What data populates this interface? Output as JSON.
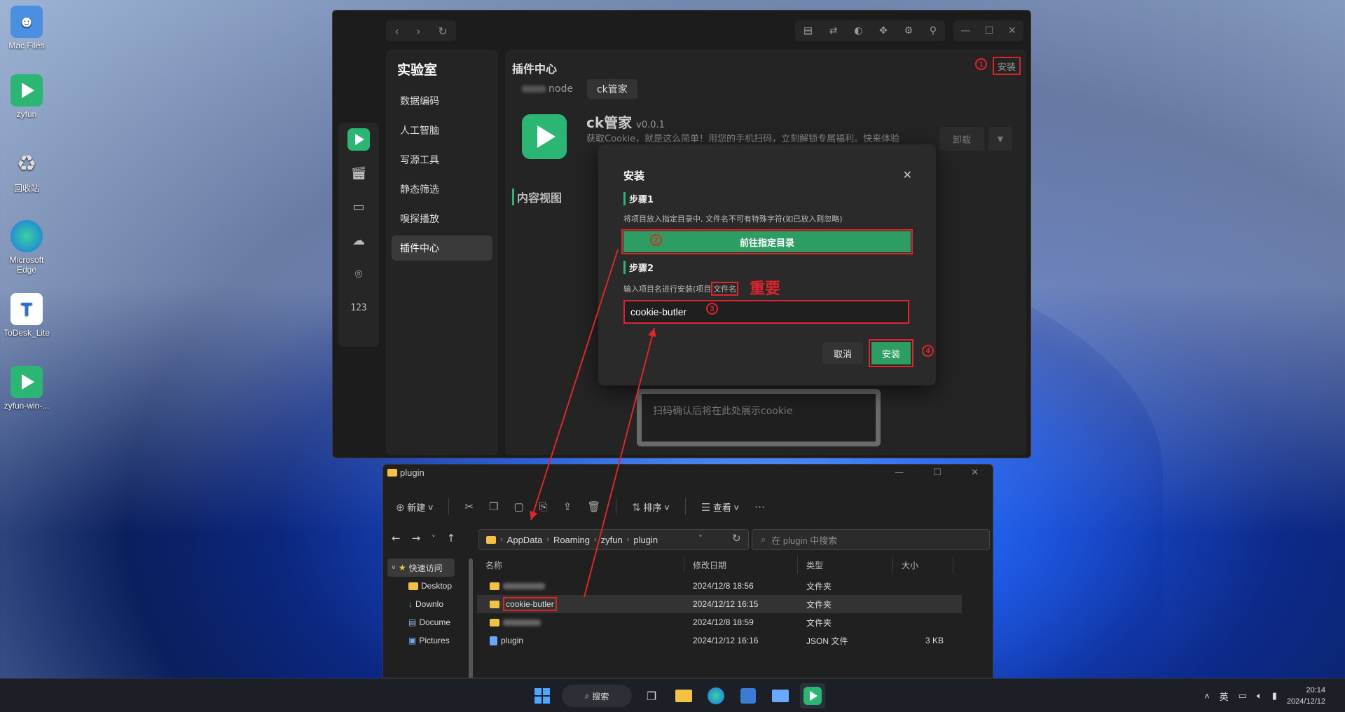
{
  "desktop": {
    "icons": [
      "Mac Files",
      "zyfun",
      "回收站",
      "Microsoft Edge",
      "ToDesk_Lite",
      "zyfun-win-..."
    ]
  },
  "app": {
    "menu_title": "实验室",
    "menu_items": [
      "数据编码",
      "人工智脑",
      "写源工具",
      "静态筛选",
      "嗅探播放",
      "插件中心"
    ],
    "content_title": "插件中心",
    "top_install_label": "安装",
    "tabs": [
      "node",
      "ck管家"
    ],
    "plugin": {
      "name": "ck管家",
      "version": "v0.0.1",
      "description": "获取Cookie，就是这么简单！用您的手机扫码，立刻解锁专属福利。快来体验",
      "unload_label": "卸载"
    },
    "content_view_title": "内容视图",
    "cookie_placeholder": "扫码确认后将在此处展示cookie"
  },
  "modal": {
    "title": "安装",
    "step1_title": "步骤1",
    "step1_hint": "将项目放入指定目录中, 文件名不可有特殊字符(如已放入则忽略)",
    "goto_dir_label": "前往指定目录",
    "step2_title": "步骤2",
    "step2_hint_prefix": "输入项目名进行安装(项目",
    "step2_hint_box": "文件名",
    "important_note": "重要",
    "project_name_value": "cookie-butler",
    "cancel_label": "取消",
    "confirm_label": "安装"
  },
  "markers": [
    "1",
    "2",
    "3",
    "4"
  ],
  "explorer": {
    "title": "plugin",
    "ribbon": {
      "new": "新建",
      "sort": "排序",
      "view": "查看"
    },
    "breadcrumb": [
      "AppData",
      "Roaming",
      "zyfun",
      "plugin"
    ],
    "search_placeholder": "在 plugin 中搜索",
    "tree": {
      "quick_access": "快速访问",
      "items": [
        "Desktop",
        "Downlo",
        "Docume",
        "Pictures"
      ]
    },
    "columns": [
      "名称",
      "修改日期",
      "类型",
      "大小"
    ],
    "rows": [
      {
        "name": "",
        "date": "2024/12/8 18:56",
        "type": "文件夹",
        "size": ""
      },
      {
        "name": "cookie-butler",
        "date": "2024/12/12 16:15",
        "type": "文件夹",
        "size": ""
      },
      {
        "name": "",
        "date": "2024/12/8 18:59",
        "type": "文件夹",
        "size": ""
      },
      {
        "name": "plugin",
        "date": "2024/12/12 16:16",
        "type": "JSON 文件",
        "size": "3 KB"
      }
    ]
  },
  "taskbar": {
    "search_label": "搜索",
    "ime": "英",
    "time": "20:14",
    "date": "2024/12/12"
  },
  "colors": {
    "accent_green": "#2d9d64",
    "annotation_red": "#e0242b"
  }
}
